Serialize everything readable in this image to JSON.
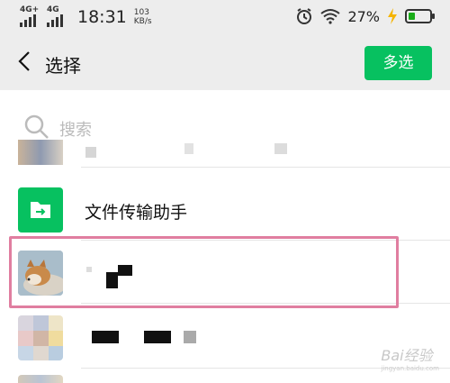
{
  "status_bar": {
    "net1": "4G+",
    "net2": "4G",
    "time": "18:31",
    "speed_value": "103",
    "speed_unit": "KB/s",
    "battery_percent": "27%",
    "battery_level": 0.27,
    "icons": [
      "signal-icon",
      "alarm-icon",
      "wifi-icon",
      "charging-icon",
      "battery-icon"
    ]
  },
  "title_bar": {
    "title": "选择",
    "multi_select_label": "多选"
  },
  "search": {
    "placeholder": "搜索"
  },
  "contacts": [
    {
      "name": "文件传输助手",
      "avatar": "folder-icon",
      "avatar_color": "#07c160"
    },
    {
      "name": "",
      "avatar": "dog-photo",
      "redacted": true
    },
    {
      "name": "",
      "avatar": "pixelated-photo",
      "redacted": true
    }
  ],
  "watermark": {
    "text": "Bai经验",
    "sub": "jingyan.baidu.com"
  },
  "colors": {
    "accent": "#07c160",
    "highlight_border": "#e07ea0",
    "background": "#ededed"
  }
}
